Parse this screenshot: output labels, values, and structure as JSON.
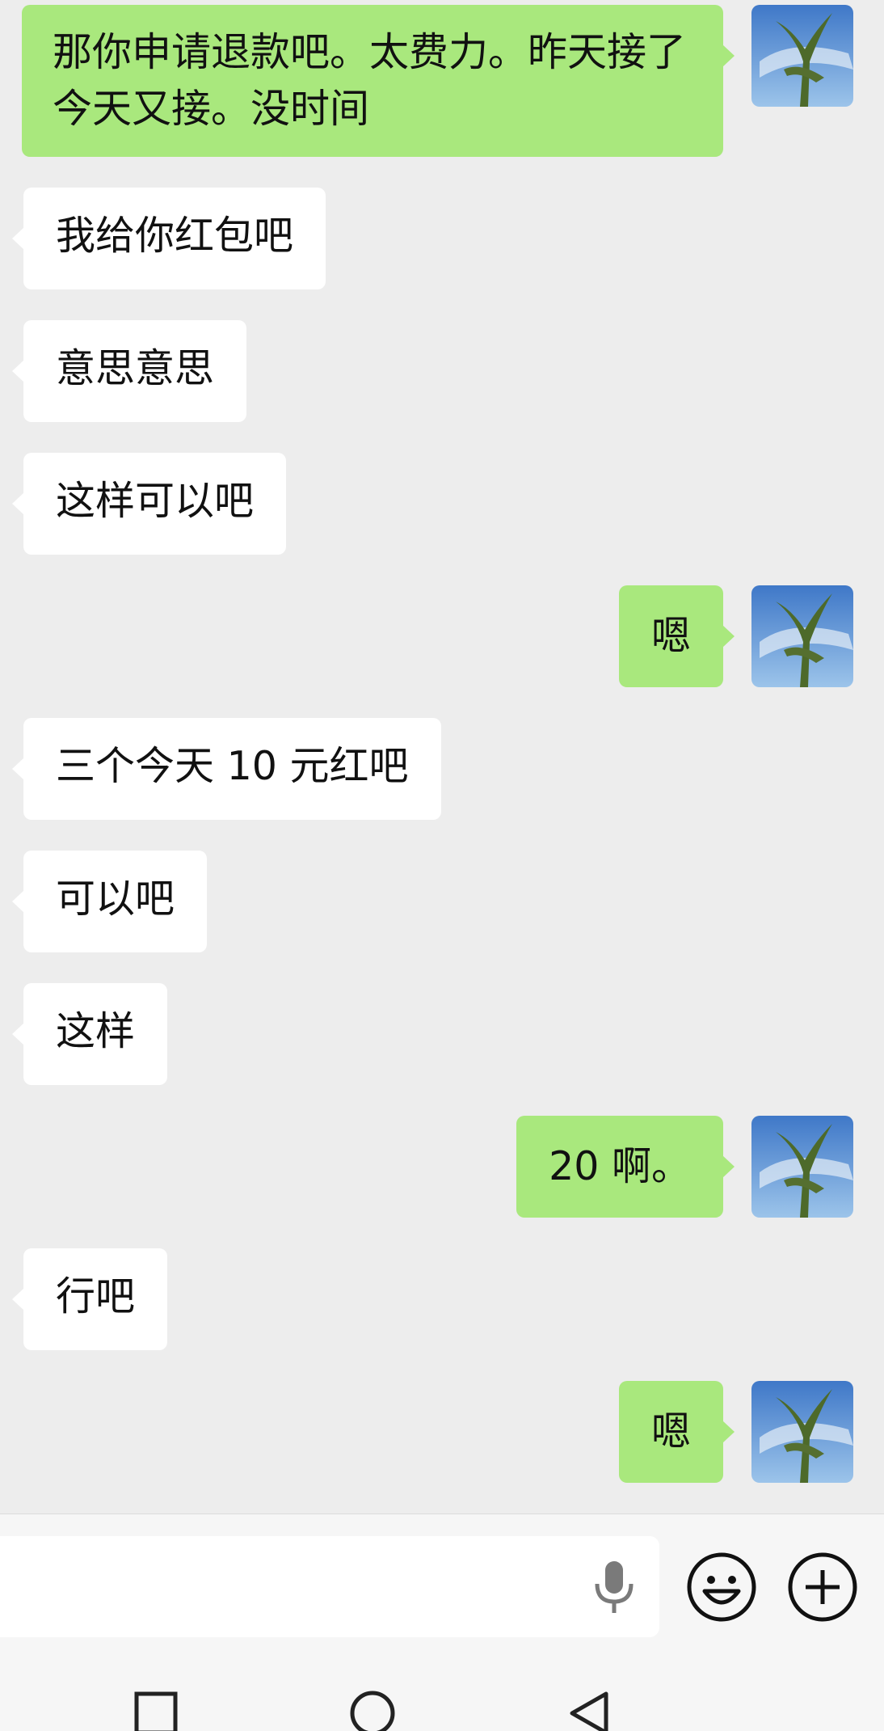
{
  "messages": [
    {
      "side": "out",
      "text": "那你申请退款吧。太费力。昨天接了今天又接。没时间"
    },
    {
      "side": "in",
      "text": "我给你红包吧"
    },
    {
      "side": "in",
      "text": "意思意思"
    },
    {
      "side": "in",
      "text": "这样可以吧"
    },
    {
      "side": "out",
      "text": "嗯"
    },
    {
      "side": "in",
      "text": "三个今天 10 元红吧"
    },
    {
      "side": "in",
      "text": "可以吧"
    },
    {
      "side": "in",
      "text": "这样"
    },
    {
      "side": "out",
      "text": "20 啊。"
    },
    {
      "side": "in",
      "text": "行吧"
    },
    {
      "side": "out",
      "text": "嗯"
    }
  ],
  "input_bar": {
    "placeholder": "",
    "icons": [
      "microphone-icon",
      "emoji-icon",
      "plus-icon"
    ]
  },
  "nav_bar": {
    "icons": [
      "recents-square-icon",
      "home-circle-icon",
      "back-triangle-icon"
    ]
  },
  "colors": {
    "background": "#ededed",
    "outgoing_bubble": "#a9e87d",
    "incoming_bubble": "#ffffff"
  }
}
